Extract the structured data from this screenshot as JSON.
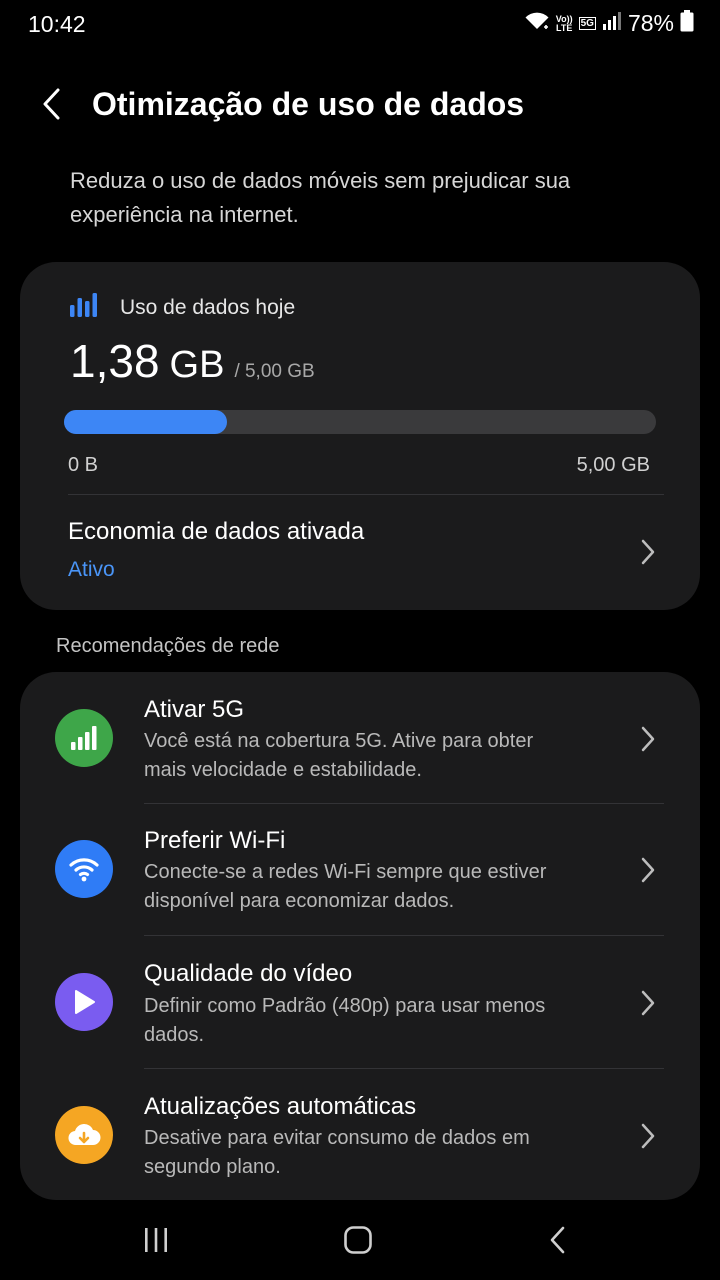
{
  "status_bar": {
    "time": "10:42",
    "volte_top": "Vo))",
    "volte_bottom": "LTE",
    "network_badge": "5G",
    "battery": "78%",
    "icons": [
      "wifi-icon",
      "volte-icon",
      "5g-icon",
      "signal-icon",
      "battery-icon"
    ]
  },
  "header": {
    "title": "Otimização de uso de dados",
    "back_icon": "chevron-left-icon"
  },
  "subtitle": "Reduza o uso de dados móveis sem prejudicar sua experiência na internet.",
  "usage": {
    "label": "Uso de dados hoje",
    "value": "1,38",
    "unit": "GB",
    "limit": "/ 5,00 GB",
    "progress_fraction": 0.276,
    "range_min": "0 B",
    "range_max": "5,00 GB",
    "icon": "bar-chart-icon"
  },
  "data_saver": {
    "title": "Economia de dados ativada",
    "status": "Ativo"
  },
  "recommendations": {
    "header": "Recomendações de rede",
    "items": [
      {
        "title": "Ativar 5G",
        "description": "Você está na cobertura 5G. Ative para obter mais velocidade e estabilidade.",
        "icon": "signal-bars-icon",
        "icon_color": "#3ea649"
      },
      {
        "title": "Preferir Wi-Fi",
        "description": "Conecte-se a redes Wi-Fi sempre que estiver disponível para economizar dados.",
        "icon": "wifi-icon",
        "icon_color": "#2f7cf6"
      },
      {
        "title": "Qualidade do vídeo",
        "description": "Definir como Padrão (480p) para usar menos dados.",
        "icon": "play-icon",
        "icon_color": "#7a5cf0"
      },
      {
        "title": "Atualizações automáticas",
        "description": "Desative para evitar consumo de dados em segundo plano.",
        "icon": "cloud-download-icon",
        "icon_color": "#f5a623"
      }
    ]
  },
  "colors": {
    "accent": "#3d86f5",
    "status_active": "#4a95f7",
    "card_background": "#1b1b1c",
    "background": "#000000"
  },
  "nav_bar": {
    "buttons": [
      "recents-icon",
      "home-icon",
      "back-icon"
    ]
  }
}
